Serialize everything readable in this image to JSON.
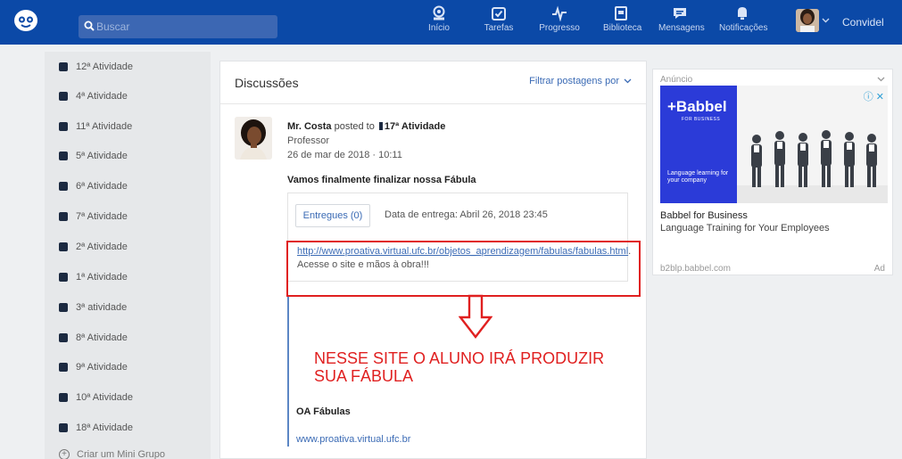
{
  "search": {
    "placeholder": "Buscar"
  },
  "nav": [
    {
      "label": "Início",
      "icon": "home-icon"
    },
    {
      "label": "Tarefas",
      "icon": "tasks-icon"
    },
    {
      "label": "Progresso",
      "icon": "progress-icon"
    },
    {
      "label": "Biblioteca",
      "icon": "library-icon"
    },
    {
      "label": "Mensagens",
      "icon": "messages-icon"
    },
    {
      "label": "Notificações",
      "icon": "notifications-icon"
    }
  ],
  "user": {
    "name": "Convidel"
  },
  "sidebar": {
    "items": [
      "12ª Atividade",
      "4ª Atividade",
      "11ª Atividade",
      "5ª Atividade",
      "6ª Atividade",
      "7ª Atividade",
      "2ª Atividade",
      "1ª Atividade",
      "3ª atividade",
      "8ª Atividade",
      "9ª Atividade",
      "10ª Atividade",
      "18ª Atividade"
    ],
    "create_label": "Criar um Mini Grupo"
  },
  "discussions": {
    "title": "Discussões",
    "filter_label": "Filtrar postagens por",
    "post": {
      "author": "Mr. Costa",
      "posted_to": "posted to",
      "activity": "17ª Atividade",
      "role": "Professor",
      "date": "26 de mar de 2018 · 10:11",
      "title": "Vamos finalmente finalizar nossa Fábula",
      "delivered_button": "Entregues (0)",
      "due_date": "Data de entrega: Abril 26, 2018 23:45",
      "link_url": "http://www.proativa.virtual.ufc.br/objetos_aprendizagem/fabulas/fabulas.html",
      "link_text": ". Acesse o site e mãos à obra!!!",
      "annotation": "NESSE SITE O ALUNO IRÁ PRODUZIR SUA FÁBULA",
      "embed_title": "OA Fábulas",
      "embed_url": "www.proativa.virtual.ufc.br"
    }
  },
  "ad": {
    "label": "Anúncio",
    "brand": "+Babbel",
    "brand_sub": "FOR BUSINESS",
    "tagline": "Language learning for your company",
    "title": "Babbel for Business",
    "subtitle": "Language Training for Your Employees",
    "domain": "b2blp.babbel.com",
    "badge": "Ad"
  },
  "colors": {
    "topbar": "#0b49a7",
    "link": "#3b6bb5",
    "annotation": "#e02020",
    "ad_blue": "#2b3bd8"
  }
}
